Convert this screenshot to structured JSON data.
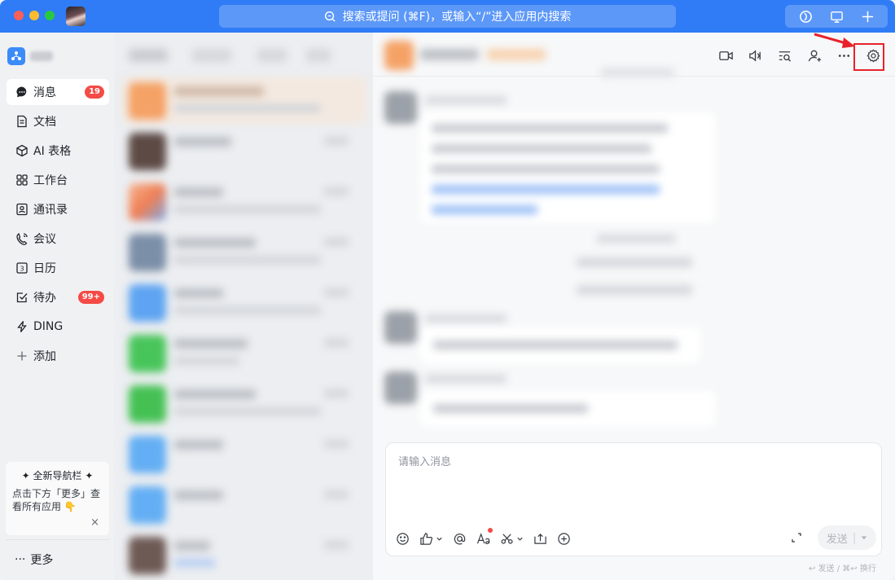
{
  "titlebar": {
    "search_placeholder": "搜索或提问 (⌘F)，或输入“/”进入应用内搜索"
  },
  "sidebar": {
    "items": [
      {
        "label": "消息",
        "icon": "message-icon",
        "badge": "19",
        "active": true
      },
      {
        "label": "文档",
        "icon": "document-icon"
      },
      {
        "label": "AI 表格",
        "icon": "ai-table-icon"
      },
      {
        "label": "工作台",
        "icon": "workbench-icon"
      },
      {
        "label": "通讯录",
        "icon": "contacts-icon"
      },
      {
        "label": "会议",
        "icon": "meeting-icon"
      },
      {
        "label": "日历",
        "icon": "calendar-icon"
      },
      {
        "label": "待办",
        "icon": "todo-icon",
        "badge": "99+"
      },
      {
        "label": "DING",
        "icon": "ding-icon"
      },
      {
        "label": "添加",
        "icon": "plus-icon"
      }
    ],
    "promo": {
      "title": "全新导航栏",
      "desc": "点击下方「更多」查看所有应用 👇",
      "close": "×"
    },
    "more_label": "更多"
  },
  "chat": {
    "input_placeholder": "请输入消息",
    "send_label": "发送",
    "shortcut_hint": "↩ 发送 / ⌘↩ 换行"
  },
  "colors": {
    "titlebar": "#2f7cf6",
    "badge": "#f54a45",
    "highlight": "#e8222b"
  }
}
